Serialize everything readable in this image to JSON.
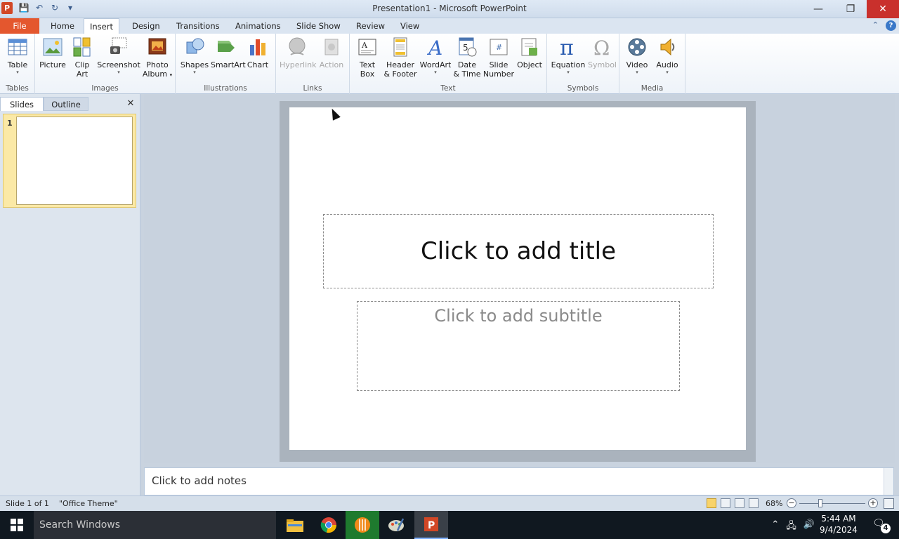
{
  "window": {
    "title": "Presentation1 - Microsoft PowerPoint",
    "app_icon_letter": "P"
  },
  "tabs": [
    {
      "label": "File"
    },
    {
      "label": "Home"
    },
    {
      "label": "Insert"
    },
    {
      "label": "Design"
    },
    {
      "label": "Transitions"
    },
    {
      "label": "Animations"
    },
    {
      "label": "Slide Show"
    },
    {
      "label": "Review"
    },
    {
      "label": "View"
    }
  ],
  "ribbon": {
    "groups": {
      "tables": "Tables",
      "images": "Images",
      "illustrations": "Illustrations",
      "links": "Links",
      "text": "Text",
      "symbols": "Symbols",
      "media": "Media"
    },
    "buttons": {
      "table": "Table",
      "picture": "Picture",
      "clip_art_1": "Clip",
      "clip_art_2": "Art",
      "screenshot": "Screenshot",
      "photo_album_1": "Photo",
      "photo_album_2": "Album",
      "shapes": "Shapes",
      "smartart": "SmartArt",
      "chart": "Chart",
      "hyperlink": "Hyperlink",
      "action": "Action",
      "text_box_1": "Text",
      "text_box_2": "Box",
      "header_footer_1": "Header",
      "header_footer_2": "& Footer",
      "wordart": "WordArt",
      "date_time_1": "Date",
      "date_time_2": "& Time",
      "slide_number_1": "Slide",
      "slide_number_2": "Number",
      "object": "Object",
      "equation": "Equation",
      "symbol": "Symbol",
      "video": "Video",
      "audio": "Audio"
    }
  },
  "left_pane": {
    "tab_slides": "Slides",
    "tab_outline": "Outline",
    "close": "✕",
    "slide_number": "1"
  },
  "slide": {
    "title_placeholder": "Click to add title",
    "subtitle_placeholder": "Click to add subtitle"
  },
  "notes": {
    "placeholder": "Click to add notes"
  },
  "status_bar": {
    "slide_info": "Slide 1 of 1",
    "theme": "\"Office Theme\"",
    "zoom": "68%",
    "zoom_fraction": 0.3
  },
  "taskbar": {
    "search_placeholder": "Search Windows",
    "time": "5:44 AM",
    "date": "9/4/2024",
    "notification_count": "4"
  },
  "colors": {
    "file_tab": "#e4572e",
    "close_button": "#c9302c",
    "thumb_highlight": "#fbe9a6"
  }
}
